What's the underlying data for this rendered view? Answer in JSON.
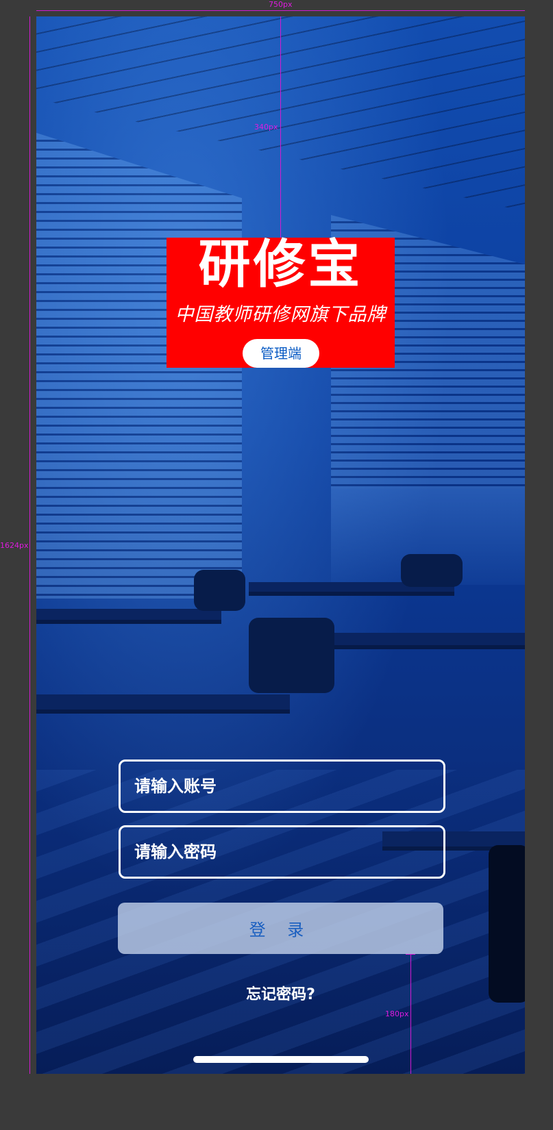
{
  "annotations": {
    "width_label": "750px",
    "height_label": "1624px",
    "top_offset_label": "340px",
    "bottom_offset_label": "180px"
  },
  "logo": {
    "title": "研修宝",
    "slogan": "中国教师研修网旗下品牌",
    "role": "管理端",
    "background_color": "#ff0000"
  },
  "form": {
    "account_placeholder": "请输入账号",
    "password_placeholder": "请输入密码",
    "login_label": "登 录",
    "forgot_label": "忘记密码?"
  },
  "colors": {
    "accent": "#0a5bc4",
    "background": "#0b3c9c"
  }
}
